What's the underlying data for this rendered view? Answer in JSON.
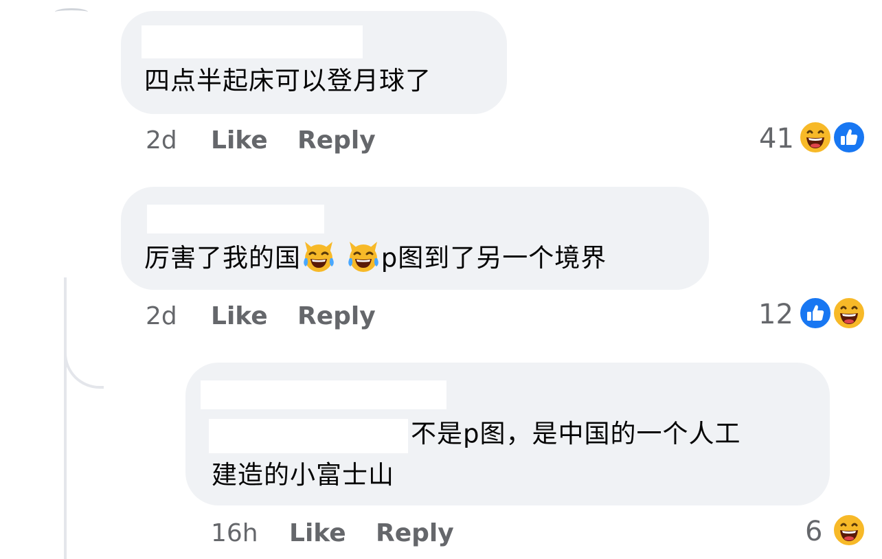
{
  "comments": [
    {
      "text": "四点半起床可以登月球了",
      "time": "2d",
      "like_label": "Like",
      "reply_label": "Reply",
      "reaction_count": "41",
      "reactions": [
        "haha-icon",
        "like-icon"
      ]
    },
    {
      "text_before": "厉害了我的国",
      "emoji": [
        "cat-tears-of-joy-icon",
        "cat-tears-of-joy-icon"
      ],
      "text_after": "p图到了另一个境界",
      "time": "2d",
      "like_label": "Like",
      "reply_label": "Reply",
      "reaction_count": "12",
      "reactions": [
        "like-icon",
        "haha-icon"
      ]
    },
    {
      "text_line1": "不是p图，是中国的一个人工",
      "text_line2": "建造的小富士山",
      "time": "16h",
      "like_label": "Like",
      "reply_label": "Reply",
      "reaction_count": "6",
      "reactions": [
        "haha-icon"
      ]
    }
  ],
  "colors": {
    "bubble": "#f0f2f5",
    "meta_text": "#65676b",
    "like_blue": "#1877f2",
    "haha_yellow": "#f7b928",
    "thread_line": "#e4e6eb"
  }
}
